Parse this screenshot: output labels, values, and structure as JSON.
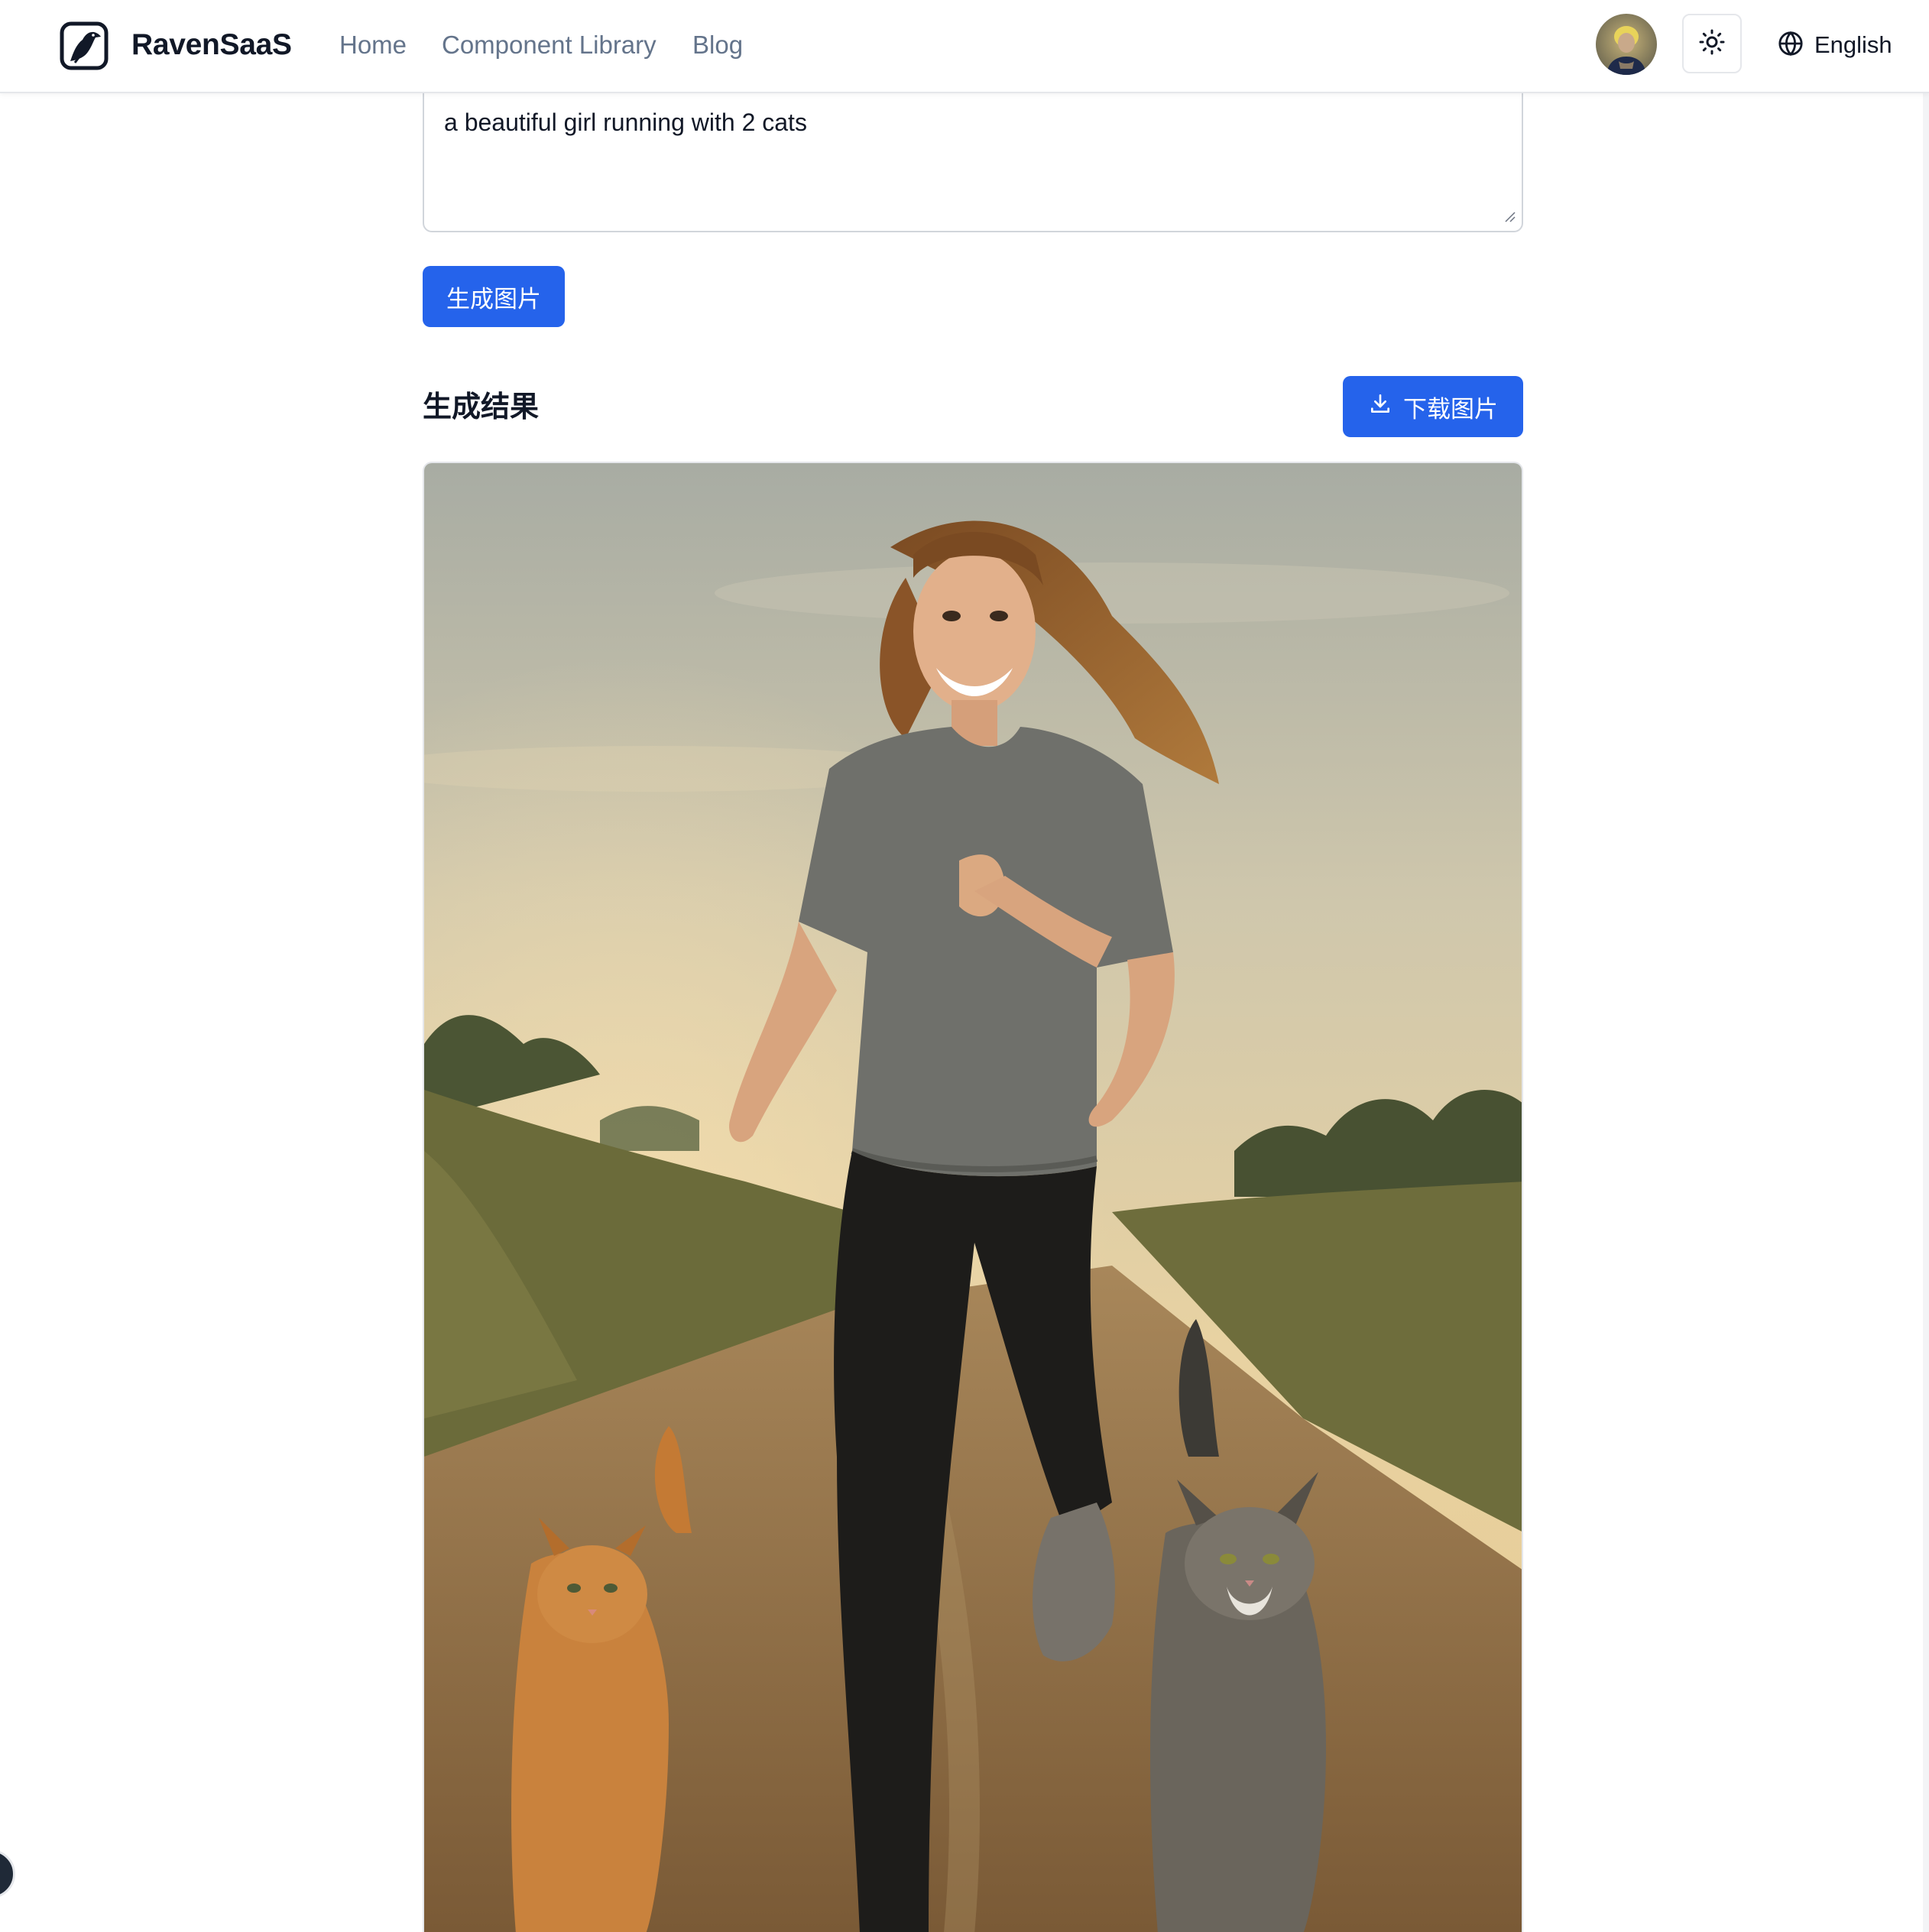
{
  "header": {
    "brand": "RavenSaaS",
    "nav": [
      {
        "label": "Home"
      },
      {
        "label": "Component Library"
      },
      {
        "label": "Blog"
      }
    ],
    "language": "English",
    "theme_icon": "sun-icon",
    "language_icon": "globe-icon",
    "logo_icon": "raven-icon"
  },
  "prompt": {
    "value": "a beautiful girl running with 2 cats"
  },
  "actions": {
    "generate_label": "生成图片",
    "download_label": "下载图片",
    "download_icon": "download-icon"
  },
  "result": {
    "title": "生成结果"
  },
  "colors": {
    "accent": "#2563eb",
    "nav_text": "#64748b",
    "border": "#e5e7eb"
  }
}
